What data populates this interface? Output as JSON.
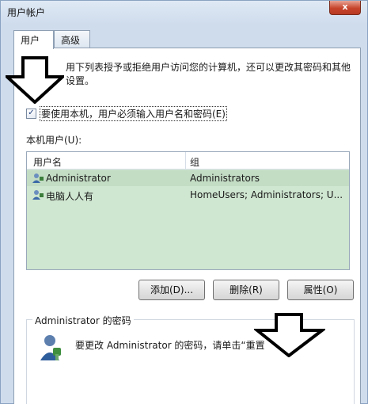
{
  "window": {
    "title": "用户帐户",
    "close_label": "x"
  },
  "tabs": [
    {
      "label": "用户"
    },
    {
      "label": "高级"
    }
  ],
  "description": "用下列表授予或拒绝用户访问您的计算机，还可以更改其密码和其他设置。",
  "checkbox": {
    "label": "要使用本机，用户必须输入用户名和密码(E)",
    "checked": true,
    "mark": "✓"
  },
  "local_users_label": "本机用户(U):",
  "table": {
    "headers": [
      "用户名",
      "组"
    ],
    "rows": [
      {
        "name": "Administrator",
        "group": "Administrators"
      },
      {
        "name": "电脑人人有",
        "group": "HomeUsers; Administrators; U..."
      }
    ]
  },
  "buttons": {
    "add": "添加(D)...",
    "remove": "删除(R)",
    "properties": "属性(O)"
  },
  "password_group": {
    "title": "Administrator 的密码",
    "text": "要更改 Administrator 的密码，请单击“重置"
  },
  "colors": {
    "list_bg": "#cfe6d0",
    "selected_row": "#c3dcc4",
    "close_button": "#c7442b"
  },
  "icons": {
    "user": "user-icon",
    "password": "user-key-icon",
    "annotation": "down-arrow-icon"
  }
}
